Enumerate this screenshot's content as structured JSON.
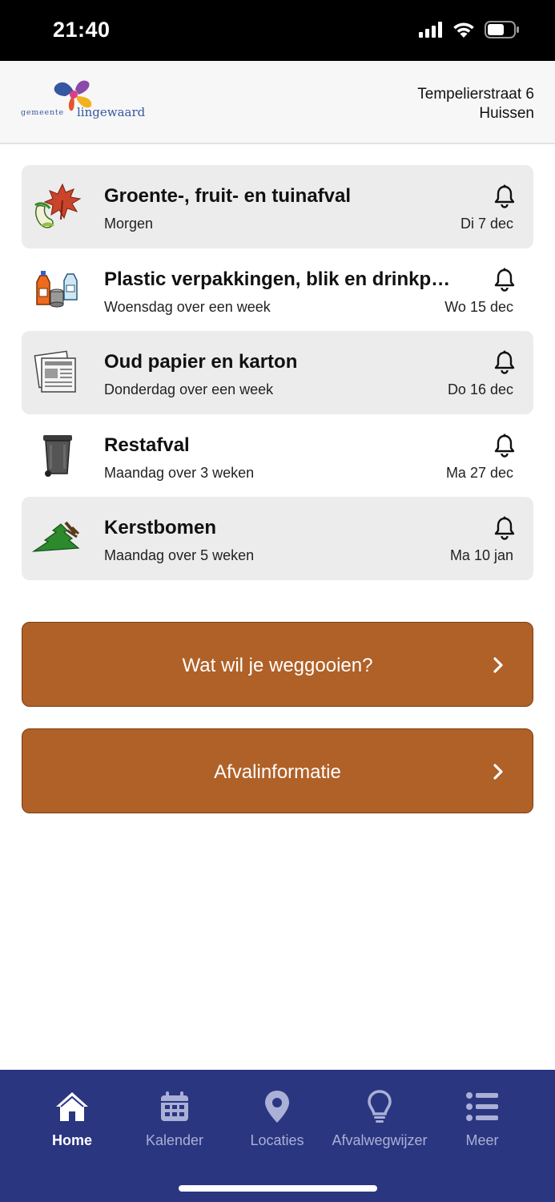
{
  "status_bar": {
    "time": "21:40"
  },
  "header": {
    "logo_small": "gemeente",
    "logo_big": "lingewaard",
    "address_line1": "Tempelierstraat 6",
    "address_line2": "Huissen"
  },
  "collections": [
    {
      "title": "Groente-, fruit- en tuinafval",
      "when": "Morgen",
      "date": "Di 7 dec",
      "icon": "gft-leaf-apple-icon"
    },
    {
      "title": "Plastic verpakkingen, blik en drinkpakken",
      "when": "Woensdag over een week",
      "date": "Wo 15 dec",
      "icon": "pmd-bottles-icon"
    },
    {
      "title": "Oud papier en karton",
      "when": "Donderdag over een week",
      "date": "Do 16 dec",
      "icon": "paper-newspaper-icon"
    },
    {
      "title": "Restafval",
      "when": "Maandag over 3 weken",
      "date": "Ma 27 dec",
      "icon": "rest-bin-icon"
    },
    {
      "title": "Kerstbomen",
      "when": "Maandag over 5 weken",
      "date": "Ma 10 jan",
      "icon": "christmas-tree-icon"
    }
  ],
  "actions": {
    "throw_away_label": "Wat wil je weggooien?",
    "info_label": "Afvalinformatie"
  },
  "tabs": [
    {
      "label": "Home",
      "icon": "home-icon",
      "active": true
    },
    {
      "label": "Kalender",
      "icon": "calendar-icon",
      "active": false
    },
    {
      "label": "Locaties",
      "icon": "location-pin-icon",
      "active": false
    },
    {
      "label": "Afvalwegwijzer",
      "icon": "lightbulb-icon",
      "active": false
    },
    {
      "label": "Meer",
      "icon": "list-icon",
      "active": false
    }
  ],
  "colors": {
    "accent_brown": "#b06128",
    "tabbar_blue": "#2a3680",
    "row_shade": "#ececec"
  }
}
